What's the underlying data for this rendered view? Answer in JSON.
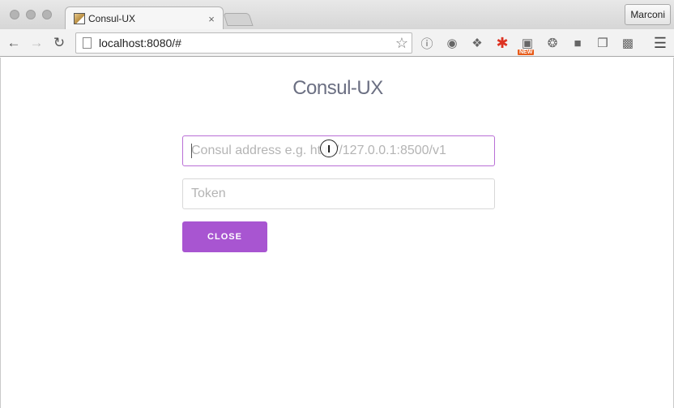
{
  "browser": {
    "tab_title": "Consul-UX",
    "tab_close": "×",
    "profile_name": "Marconi",
    "url": "localhost:8080/#",
    "icons": {
      "back": "arrow-left-icon",
      "forward": "arrow-right-icon",
      "reload": "reload-icon",
      "bookmark": "star-icon",
      "menu": "hamburger-menu-icon"
    }
  },
  "app": {
    "title": "Consul-UX",
    "address_placeholder": "Consul address e.g. http://127.0.0.1:8500/v1",
    "address_value": "",
    "token_placeholder": "Token",
    "token_value": "",
    "close_label": "CLOSE"
  },
  "colors": {
    "accent": "#a855d1",
    "title": "#6b6f82"
  }
}
